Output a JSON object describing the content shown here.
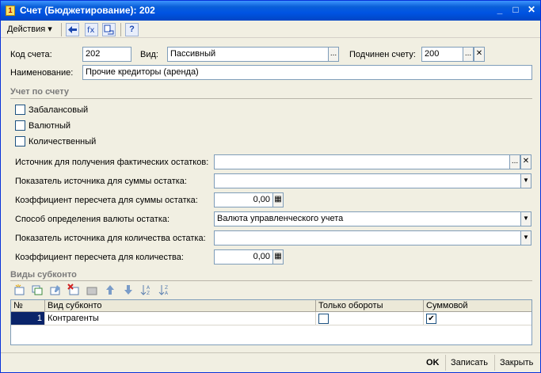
{
  "window": {
    "title": "Счет (Бюджетирование): 202",
    "minimize_glyph": "_",
    "maximize_glyph": "□",
    "close_glyph": "✕"
  },
  "toolbar": {
    "actions_label": "Действия ▾",
    "icons": [
      "arrow-left-icon",
      "formula-icon",
      "transfer-icon",
      "help-icon"
    ],
    "help_glyph": "?"
  },
  "header": {
    "code_label": "Код счета:",
    "code_value": "202",
    "type_label": "Вид:",
    "type_value": "Пассивный",
    "parent_label": "Подчинен счету:",
    "parent_value": "200",
    "name_label": "Наименование:",
    "name_value": "Прочие кредиторы (аренда)"
  },
  "accounting": {
    "section_title": "Учет по счету",
    "checkboxes": [
      {
        "label": "Забалансовый",
        "checked": false
      },
      {
        "label": "Валютный",
        "checked": false
      },
      {
        "label": "Количественный",
        "checked": false
      }
    ]
  },
  "params": {
    "source_label": "Источник для получения фактических остатков:",
    "source_value": "",
    "sum_indicator_label": "Показатель источника для суммы остатка:",
    "sum_indicator_value": "",
    "sum_coef_label": "Коэффициент пересчета для суммы остатка:",
    "sum_coef_value": "0,00",
    "currency_method_label": "Способ определения валюты остатка:",
    "currency_method_value": "Валюта управленческого учета",
    "qty_indicator_label": "Показатель источника для количества остатка:",
    "qty_indicator_value": "",
    "qty_coef_label": "Коэффициент пересчета для количества:",
    "qty_coef_value": "0,00"
  },
  "subconto": {
    "section_title": "Виды субконто",
    "columns": [
      "№",
      "Вид субконто",
      "Только обороты",
      "Суммовой"
    ],
    "rows": [
      {
        "num": "1",
        "kind": "Контрагенты",
        "only_turnover": false,
        "sum": true
      }
    ]
  },
  "footer": {
    "ok_label": "OK",
    "save_label": "Записать",
    "close_label": "Закрыть"
  },
  "glyphs": {
    "ellipsis": "...",
    "clear": "✕",
    "dropdown": "▼",
    "calc": "▦",
    "check": "✔"
  }
}
